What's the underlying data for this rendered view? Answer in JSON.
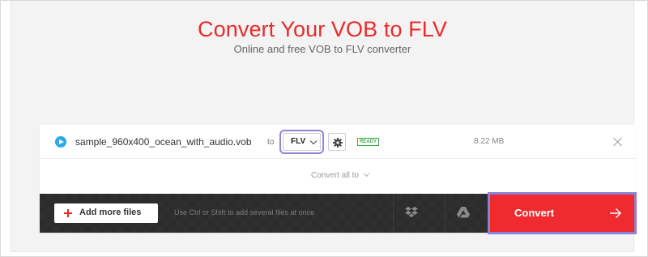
{
  "header": {
    "title": "Convert Your VOB to FLV",
    "subtitle": "Online and free VOB to FLV converter"
  },
  "file": {
    "name": "sample_960x400_ocean_with_audio.vob",
    "to_label": "to",
    "format": "FLV",
    "status": "READY",
    "size": "8.22 MB"
  },
  "convert_all": {
    "label": "Convert all to"
  },
  "toolbar": {
    "add_label": "Add more files",
    "hint": "Use Ctrl or Shift to add several files at once",
    "convert_label": "Convert"
  },
  "icons": {
    "file_type": "play-icon",
    "settings": "gear-icon",
    "remove": "close-icon",
    "add": "plus-icon",
    "dropbox": "dropbox-icon",
    "google_drive": "google-drive-icon",
    "convert_arrow": "arrow-right-icon"
  },
  "colors": {
    "accent_red": "#ef2b2f",
    "title_red": "#ec2b2b",
    "ready_green": "#3cb043",
    "highlight_purple": "#8a82d6",
    "toolbar_dark": "#2c2c2c"
  }
}
